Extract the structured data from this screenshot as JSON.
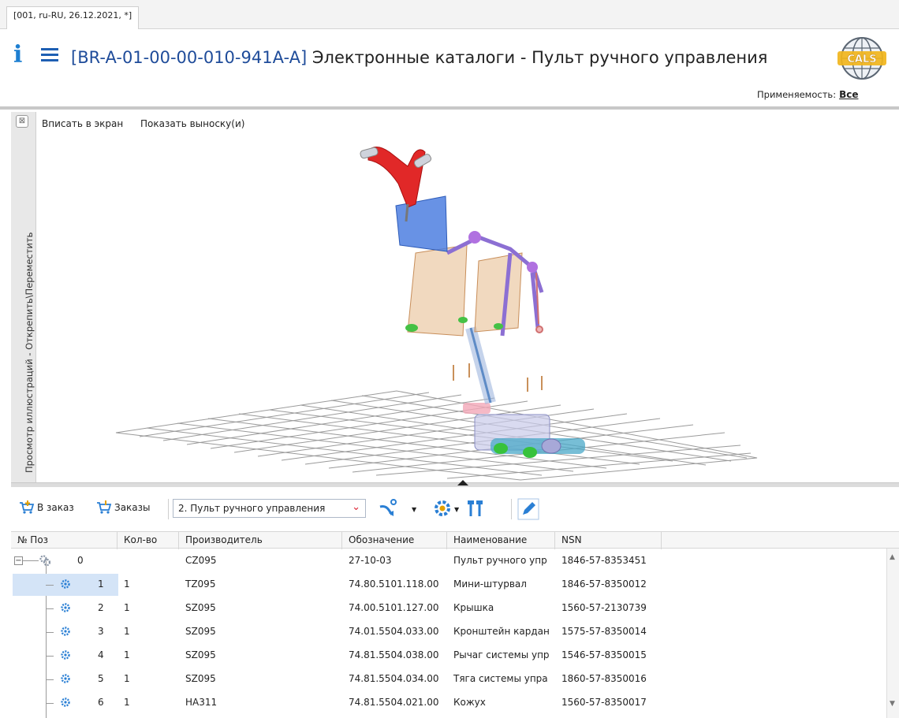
{
  "tab": {
    "label": "[001, ru-RU, 26.12.2021, *]"
  },
  "header": {
    "code": "[BR-A-01-00-00-010-941A-A]",
    "title": "Электронные каталоги - Пульт ручного управления",
    "logo_text": "CALS"
  },
  "applicability": {
    "label": "Применяемость:",
    "value": "Все"
  },
  "sidebar": {
    "close_glyph": "⊠",
    "vertical_label": "Просмотр иллюстраций - Открепить\\Переместить"
  },
  "viewer": {
    "fit_label": "Вписать в экран",
    "callout_label": "Показать выноску(и)"
  },
  "toolbar": {
    "add_to_order": "В заказ",
    "orders": "Заказы",
    "assembly_select": "2. Пульт ручного управления"
  },
  "table": {
    "columns": [
      "№ Поз",
      "Кол-во",
      "Производитель",
      "Обозначение",
      "Наименование",
      "NSN"
    ],
    "rows": [
      {
        "pos": "0",
        "qty": "",
        "maker": "CZ095",
        "designation": "27-10-03",
        "name": "Пульт ручного упр",
        "nsn": "1846-57-8353451"
      },
      {
        "pos": "1",
        "qty": "1",
        "maker": "TZ095",
        "designation": "74.80.5101.118.00",
        "name": "Мини-штурвал",
        "nsn": "1846-57-8350012"
      },
      {
        "pos": "2",
        "qty": "1",
        "maker": "SZ095",
        "designation": "74.00.5101.127.00",
        "name": "Крышка",
        "nsn": "1560-57-2130739"
      },
      {
        "pos": "3",
        "qty": "1",
        "maker": "SZ095",
        "designation": "74.01.5504.033.00",
        "name": "Кронштейн кардан",
        "nsn": "1575-57-8350014"
      },
      {
        "pos": "4",
        "qty": "1",
        "maker": "SZ095",
        "designation": "74.81.5504.038.00",
        "name": "Рычаг системы упр",
        "nsn": "1546-57-8350015"
      },
      {
        "pos": "5",
        "qty": "1",
        "maker": "SZ095",
        "designation": "74.81.5504.034.00",
        "name": "Тяга системы упра",
        "nsn": "1860-57-8350016"
      },
      {
        "pos": "6",
        "qty": "1",
        "maker": "HA311",
        "designation": "74.81.5504.021.00",
        "name": "Кожух",
        "nsn": "1560-57-8350017"
      }
    ],
    "selected_pos": "1"
  },
  "colors": {
    "accent_blue": "#1e7fd1",
    "code_blue": "#1f4c9a",
    "selection": "#d4e4f7",
    "part_red": "#e02020"
  }
}
